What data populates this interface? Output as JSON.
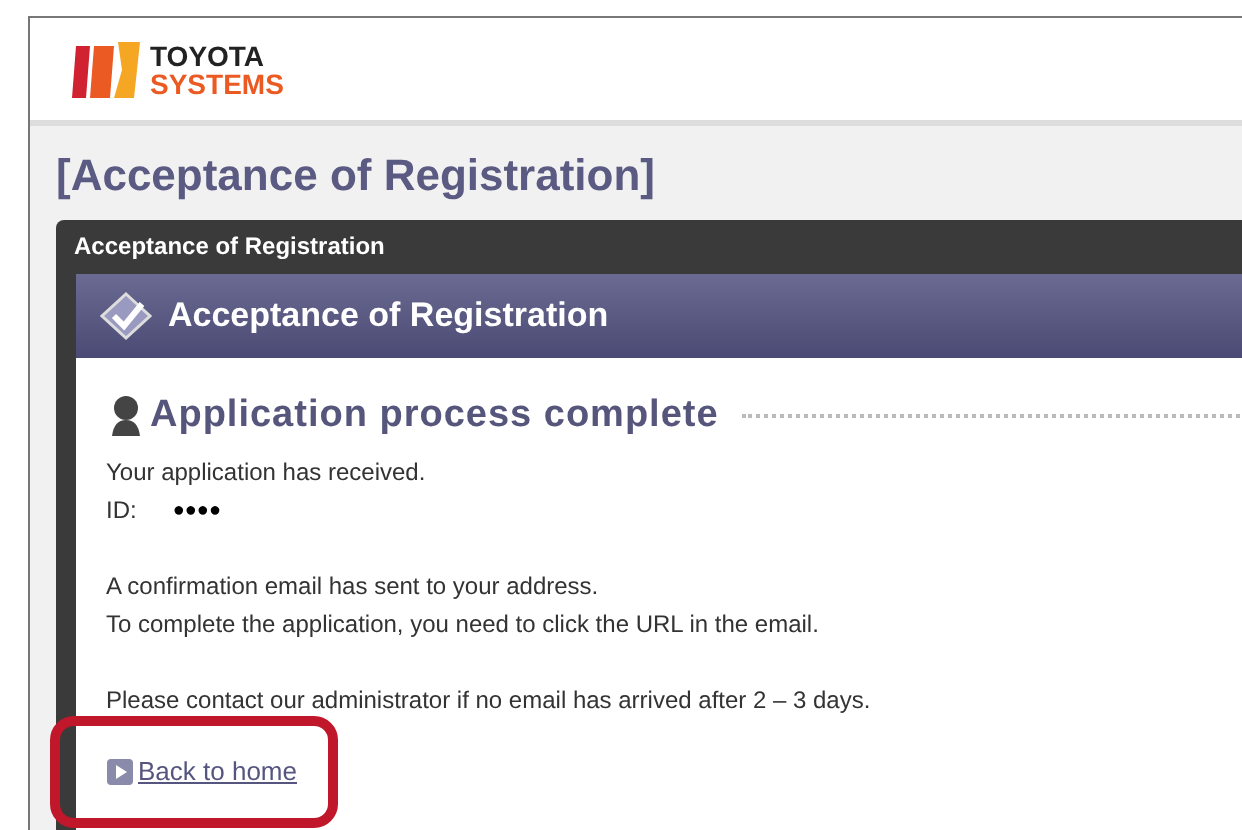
{
  "logo": {
    "line_1": "TOYOTA",
    "line_2": "SYSTEMS"
  },
  "page_title": "[Acceptance of Registration]",
  "panel": {
    "title": "Acceptance of Registration",
    "banner": "Acceptance of Registration",
    "heading": "Application process complete",
    "received": "Your application has received.",
    "id_label": "ID:",
    "id_value": "●●●●",
    "email_lines": [
      "A confirmation email has sent to your address.",
      "To complete the application, you need to click the URL in the email."
    ],
    "contact": "Please contact our administrator if no email has arrived after 2 – 3 days.",
    "link": "Back to home"
  }
}
